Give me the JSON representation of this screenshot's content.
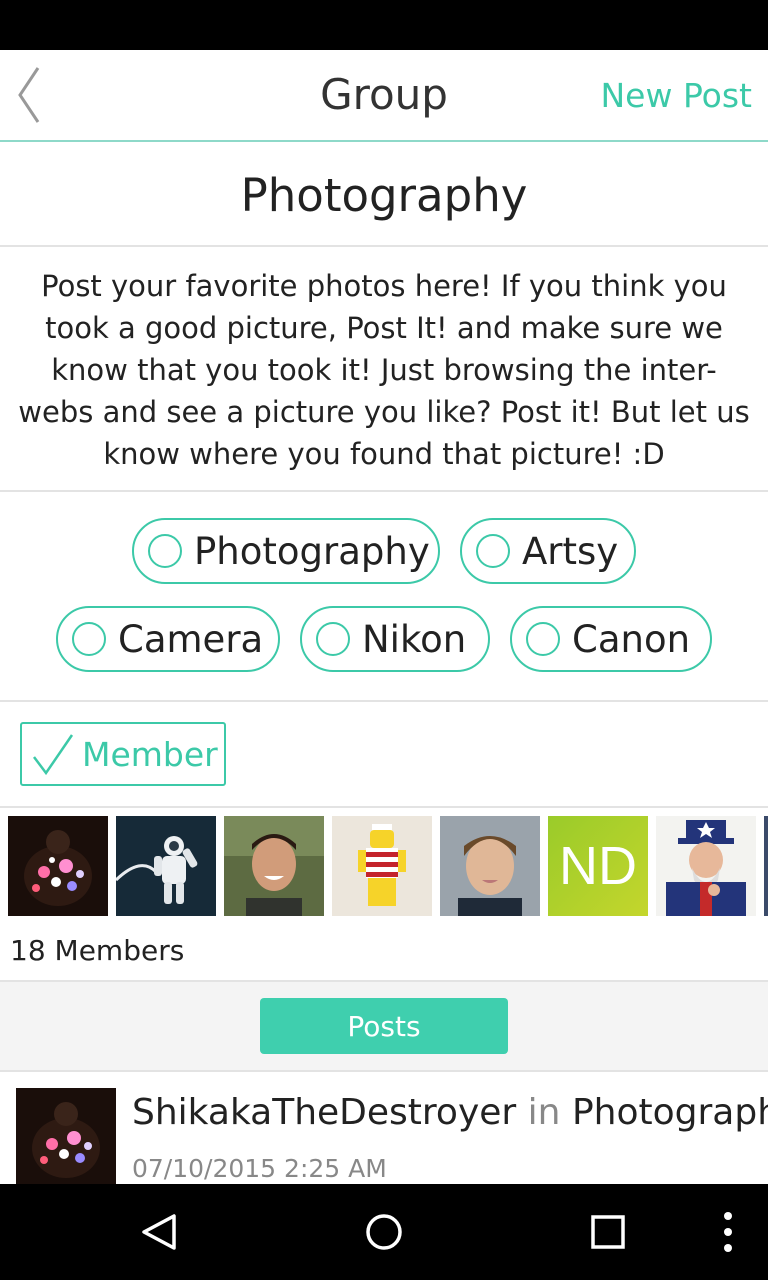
{
  "app_bar": {
    "back_icon": "chevron-left-icon",
    "title": "Group",
    "new_post_label": "New Post"
  },
  "group": {
    "name": "Photography",
    "description": "Post your favorite photos here! If you think you took a good picture, Post It! and make sure we know that you took it! Just browsing the inter-webs and see a picture you like? Post it! But let us know where you found that picture! :D"
  },
  "tags": [
    {
      "label": "Photography",
      "selected": false
    },
    {
      "label": "Artsy",
      "selected": false
    },
    {
      "label": "Camera",
      "selected": false
    },
    {
      "label": "Nikon",
      "selected": false
    },
    {
      "label": "Canon",
      "selected": false
    }
  ],
  "membership": {
    "label": "Member",
    "checked": true
  },
  "members": {
    "avatars": [
      {
        "kind": "photo",
        "subject": "light painting"
      },
      {
        "kind": "photo",
        "subject": "astronaut"
      },
      {
        "kind": "photo",
        "subject": "smiling man"
      },
      {
        "kind": "photo",
        "subject": "lego figure"
      },
      {
        "kind": "photo",
        "subject": "young man"
      },
      {
        "kind": "initials",
        "initials": "ND"
      },
      {
        "kind": "photo",
        "subject": "uncle sam"
      },
      {
        "kind": "photo",
        "subject": "partial"
      }
    ],
    "count_label": "18 Members"
  },
  "posts_tab": {
    "label": "Posts"
  },
  "post": {
    "author": "ShikakaTheDestroyer",
    "in_word": "in",
    "group": "Photography",
    "timestamp": "07/10/2015 2:25 AM"
  },
  "colors": {
    "accent": "#3cc9a8",
    "posts_button": "#3fcfae",
    "initials_avatar": "#a8cf2a"
  },
  "nav": {
    "back_icon": "triangle-back-icon",
    "home_icon": "circle-home-icon",
    "recents_icon": "square-recents-icon",
    "menu_icon": "vertical-dots-menu-icon"
  }
}
